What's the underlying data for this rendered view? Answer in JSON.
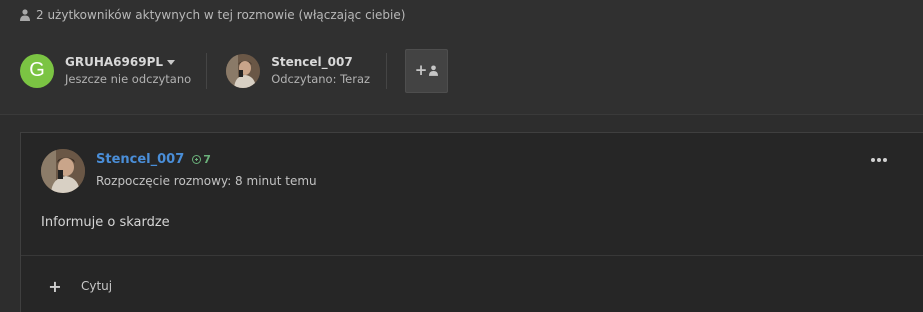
{
  "header": {
    "active_users_text": "2 użytkowników aktywnych w tej rozmowie (włączając ciebie)"
  },
  "participants": [
    {
      "avatar_letter": "G",
      "name": "GRUHA6969PL",
      "status": "Jeszcze nie odczytano"
    },
    {
      "name": "Stencel_007",
      "status": "Odczytano: Teraz"
    }
  ],
  "add_participant": {
    "icon": "add-user-icon"
  },
  "post": {
    "author": "Stencel_007",
    "reputation": "7",
    "meta": "Rozpoczęcie rozmowy: 8 minut temu",
    "body": "Informuje o skardze",
    "quote_icon": "+",
    "quote_label": "Cytuj"
  },
  "colors": {
    "background": "#2d2d2d",
    "post_background": "#262626",
    "avatar_green": "#7bc443",
    "author_link": "#4a8ed8",
    "reputation_green": "#6ab07a"
  }
}
